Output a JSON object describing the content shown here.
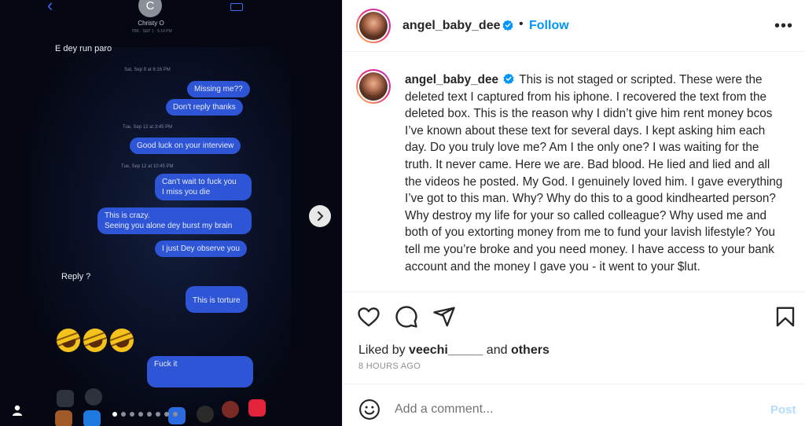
{
  "media": {
    "contact_initial": "C",
    "contact_name": "Christy O",
    "contact_sub": "TBK · SEP 1 · 5:14 PM",
    "messages": {
      "in_1": "E dey run paro",
      "ts_1": "Sat, Sep 9 at 6:16 PM",
      "out_1": "Missing me??",
      "out_2": "Don't reply thanks",
      "ts_2": "Tue, Sep 12 at 3:45 PM",
      "out_3": "Good luck on your interview",
      "ts_3": "Tue, Sep 12 at 10:45 PM",
      "out_4a": "Can't wait to fuck you",
      "out_4b": "I miss you die",
      "out_5a": "This is crazy.",
      "out_5b": "Seeing you alone dey burst my brain",
      "out_6": "I just Dey observe you",
      "in_2": "Reply ?",
      "out_7": "This is torture",
      "out_8": "Fuck it"
    },
    "emoji": [
      "rofl-emoji",
      "rofl-emoji",
      "rofl-emoji"
    ],
    "carousel": {
      "total": 8,
      "active_index": 0
    }
  },
  "post": {
    "username": "angel_baby_dee",
    "follow_label": "Follow",
    "more_label": "•••",
    "caption": "This is not staged or scripted. These were the deleted text I captured from his iphone. I recovered the text from the deleted box. This is the reason why I didn’t give him rent money bcos I’ve known about these text for several days. I kept asking him each day. Do you truly love me? Am I the only one? I was waiting for the truth. It never came. Here we are. Bad blood. He lied and lied and all the videos he posted. My God. I genuinely loved him. I gave everything I’ve got to this man. Why? Why do this to a good kindhearted person? Why destroy my life for your so called colleague? Why used me and both of you extorting money from me to fund your lavish lifestyle? You tell me you’re broke and you need money. I have access to your bank account and the money I gave you - it went to your $lut.",
    "likes": {
      "prefix": "Liked by ",
      "user": "veechi_____",
      "middle": " and ",
      "others": "others"
    },
    "time": "8 HOURS AGO",
    "comment": {
      "placeholder": "Add a comment...",
      "post_label": "Post"
    }
  },
  "colors": {
    "accent": "#0095f6",
    "imessage_blue": "#2e55d6",
    "text": "#262626",
    "muted": "#8e8e8e"
  }
}
